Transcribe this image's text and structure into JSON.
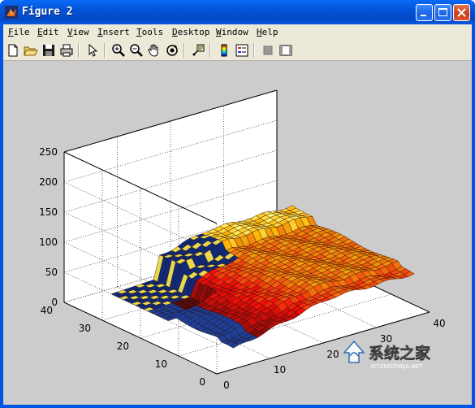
{
  "window": {
    "title": "Figure 2"
  },
  "menu": [
    "File",
    "Edit",
    "View",
    "Insert",
    "Tools",
    "Desktop",
    "Window",
    "Help"
  ],
  "toolbar": [
    "new-figure",
    "open-file",
    "save",
    "print",
    "edit-plot",
    "zoom-in",
    "zoom-out",
    "pan",
    "rotate-3d",
    "data-cursor",
    "colorbar",
    "legend",
    "hide-plot-tools",
    "show-plot-tools"
  ],
  "chart_data": {
    "type": "surface",
    "x_ticks": [
      "0",
      "10",
      "20",
      "30",
      "40"
    ],
    "y_ticks": [
      "0",
      "10",
      "20",
      "30",
      "40"
    ],
    "z_ticks": [
      "0",
      "50",
      "100",
      "150",
      "200",
      "250"
    ],
    "xlim": [
      0,
      40
    ],
    "ylim": [
      0,
      40
    ],
    "zlim": [
      0,
      250
    ],
    "grid": true,
    "surface_height_range": [
      0,
      80
    ],
    "colormap": "hot"
  },
  "watermark": {
    "text": "系统之家",
    "subtext": "XITONGZHIJIA.NET"
  }
}
